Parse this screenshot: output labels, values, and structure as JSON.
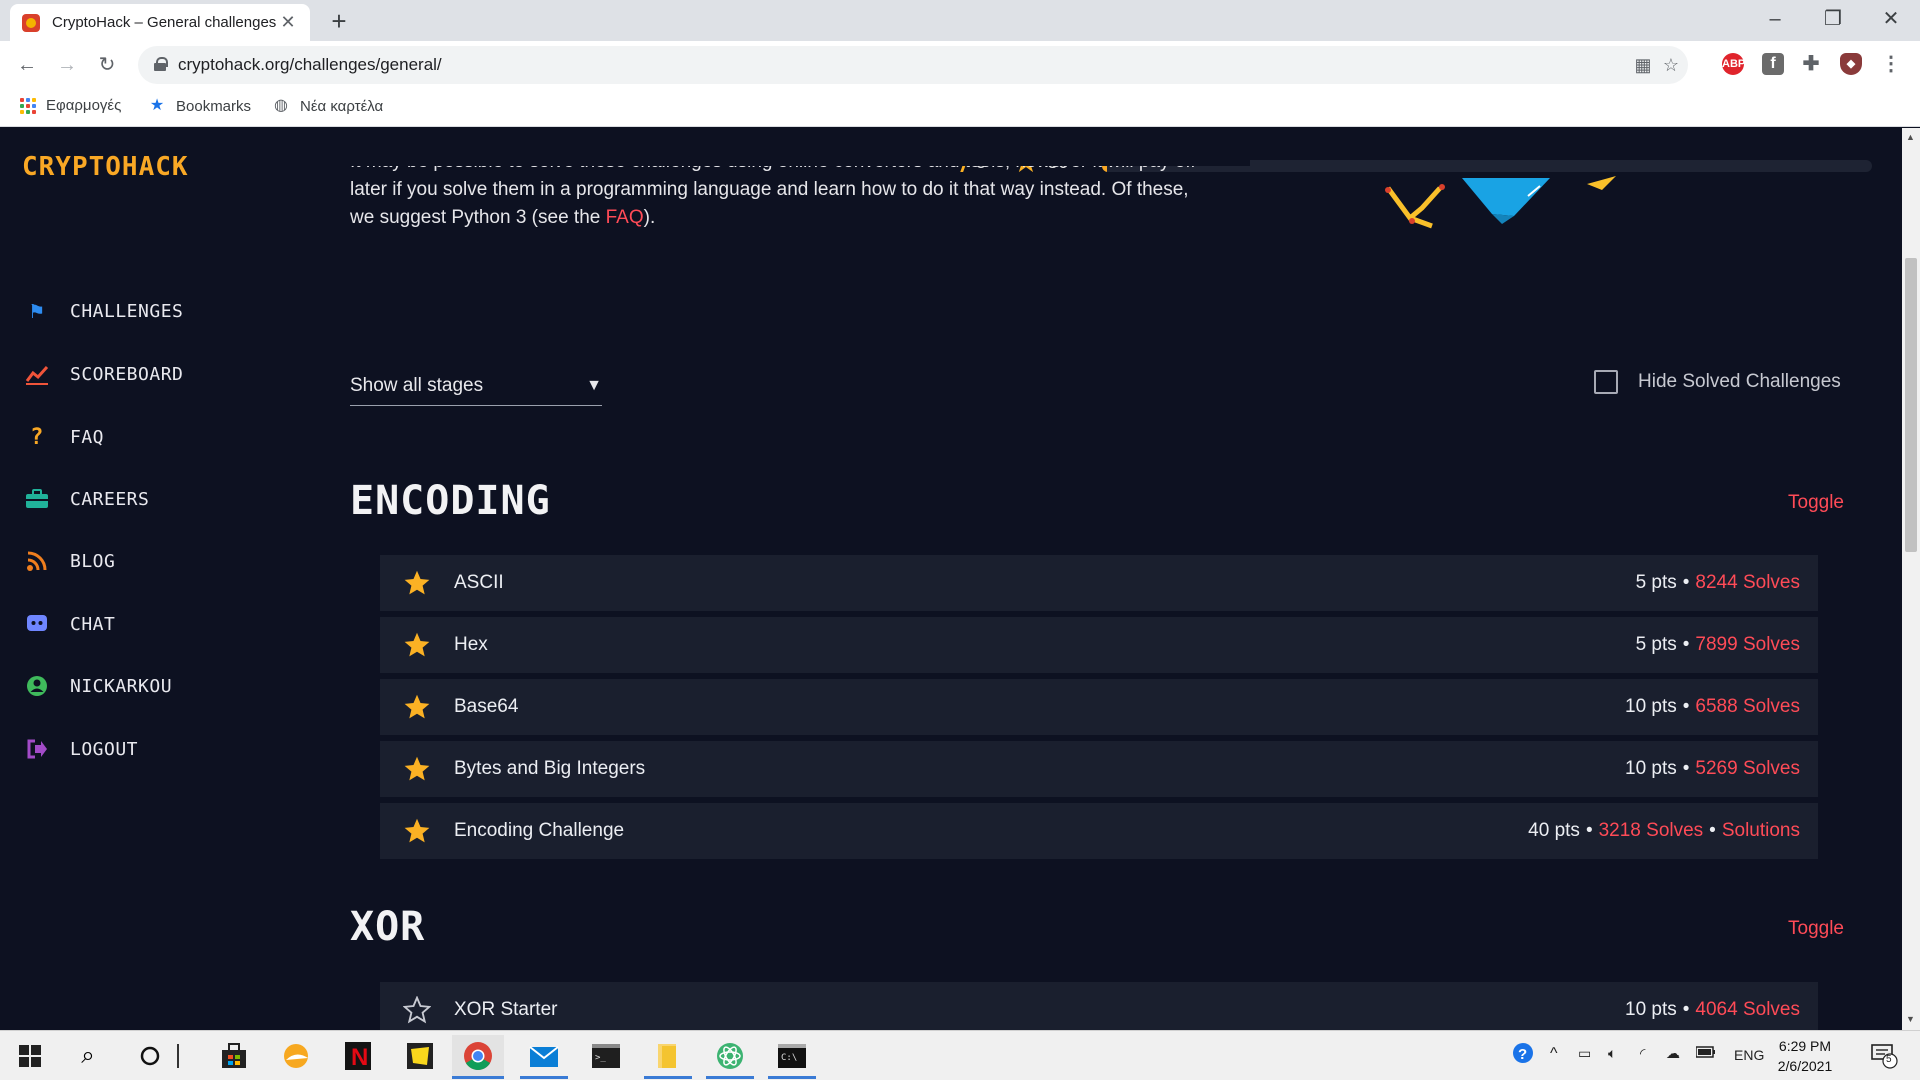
{
  "browser": {
    "tab_title": "CryptoHack – General challenges",
    "url": "cryptohack.org/challenges/general/",
    "bookmarks": [
      "Εφαρμογές",
      "Bookmarks",
      "Νέα καρτέλα"
    ],
    "extensions": {
      "abp": "ABP"
    }
  },
  "site": {
    "brand": "CRYPTOHACK",
    "stats": {
      "lightning": "5",
      "stars": "80",
      "progress_fraction": 0.006
    },
    "nav": [
      {
        "label": "CHALLENGES",
        "icon": "flag-icon",
        "color": "#2d8cf0"
      },
      {
        "label": "SCOREBOARD",
        "icon": "chart-line-icon",
        "color": "#f0543a"
      },
      {
        "label": "FAQ",
        "icon": "question-icon",
        "color": "#f9a825"
      },
      {
        "label": "CAREERS",
        "icon": "briefcase-icon",
        "color": "#20b29a"
      },
      {
        "label": "BLOG",
        "icon": "rss-icon",
        "color": "#f07f1e"
      },
      {
        "label": "CHAT",
        "icon": "discord-icon",
        "color": "#6f86ff"
      },
      {
        "label": "NICKARKOU",
        "icon": "user-icon",
        "color": "#3fba5c"
      },
      {
        "label": "LOGOUT",
        "icon": "logout-icon",
        "color": "#a24bc8"
      }
    ]
  },
  "intro": {
    "line_partial": "It may be possible to solve these challenges using online converters and tools, however it will pay off",
    "line2": "later if you solve them in a programming language and learn how to do it that way instead. Of these,",
    "line3_pre": "we suggest Python 3 (see the ",
    "line3_link": "FAQ",
    "line3_post": ")."
  },
  "filters": {
    "stage_select": "Show all stages",
    "hide_solved": "Hide Solved Challenges"
  },
  "sections": [
    {
      "title": "ENCODING",
      "toggle": "Toggle",
      "challenges": [
        {
          "name": "ASCII",
          "pts": "5 pts",
          "solves": "8244 Solves",
          "solved": true
        },
        {
          "name": "Hex",
          "pts": "5 pts",
          "solves": "7899 Solves",
          "solved": true
        },
        {
          "name": "Base64",
          "pts": "10 pts",
          "solves": "6588 Solves",
          "solved": true
        },
        {
          "name": "Bytes and Big Integers",
          "pts": "10 pts",
          "solves": "5269 Solves",
          "solved": true
        },
        {
          "name": "Encoding Challenge",
          "pts": "40 pts",
          "solves": "3218 Solves",
          "solutions": "Solutions",
          "solved": true
        }
      ]
    },
    {
      "title": "XOR",
      "toggle": "Toggle",
      "challenges": [
        {
          "name": "XOR Starter",
          "pts": "10 pts",
          "solves": "4064 Solves",
          "solved": false
        }
      ]
    }
  ],
  "taskbar": {
    "lang": "ENG",
    "time": "6:29 PM",
    "date": "2/6/2021",
    "notifications": "5"
  },
  "colors": {
    "bg": "#0d1121",
    "row_bg": "#1a1f2e",
    "accent_red": "#ff4b57",
    "accent_gold": "#f9a825"
  }
}
